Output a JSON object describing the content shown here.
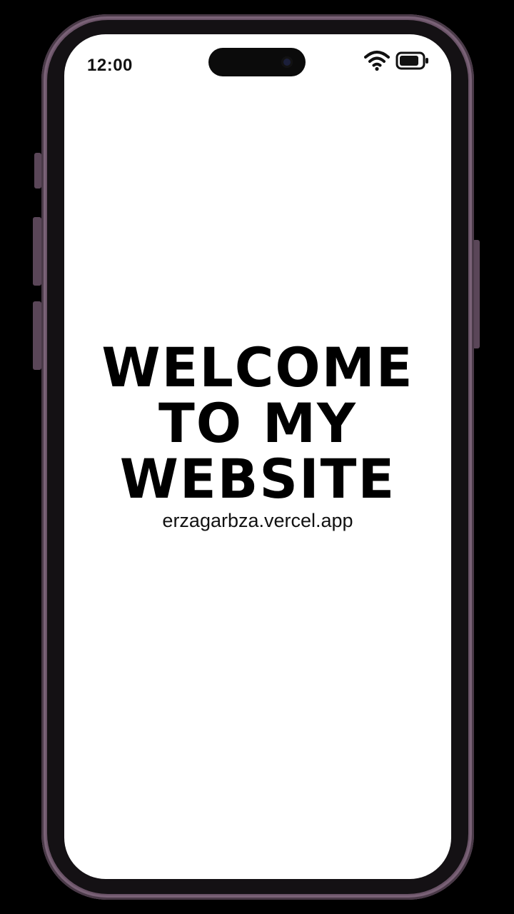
{
  "status_bar": {
    "time": "12:00",
    "wifi_icon": "wifi-icon",
    "battery_icon": "battery-icon"
  },
  "hero": {
    "title_lines": [
      "WELCOME",
      "TO MY",
      "WEBSITE"
    ],
    "url": "erzagarbza.vercel.app"
  },
  "colors": {
    "frame": "#6b5468",
    "screen": "#ffffff",
    "text": "#000000"
  }
}
